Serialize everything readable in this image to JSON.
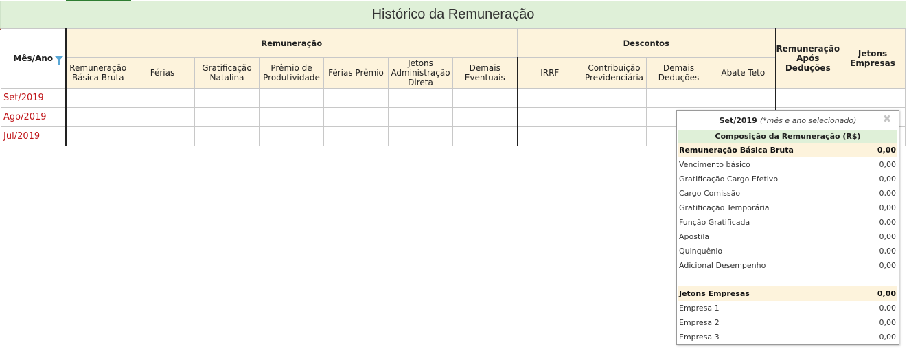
{
  "page": {
    "title": "Histórico da Remuneração"
  },
  "table": {
    "mes_ano_label": "Mês/Ano",
    "groups": {
      "remuneracao": "Remuneração",
      "descontos": "Descontos",
      "remuneracao_apos": "Remuneração Após Deduções",
      "jetons": "Jetons Empresas"
    },
    "remuneracao_cols": [
      "Remuneração Básica Bruta",
      "Férias",
      "Gratificação Natalina",
      "Prêmio de Produtividade",
      "Férias Prêmio",
      "Jetons Administração Direta",
      "Demais Eventuais"
    ],
    "descontos_cols": [
      "IRRF",
      "Contribuição Previdenciária",
      "Demais Deduções",
      "Abate Teto"
    ],
    "rows": [
      {
        "month": "Set/2019"
      },
      {
        "month": "Ago/2019"
      },
      {
        "month": "Jul/2019"
      }
    ]
  },
  "popup": {
    "month": "Set/2019",
    "note": "(*mês e ano selecionado)",
    "close_glyph": "✖",
    "composition_title": "Composição da Remuneração (R$)",
    "basic_header": {
      "label": "Remuneração Básica Bruta",
      "value": "0,00"
    },
    "basic_items": [
      {
        "label": "Vencimento básico",
        "value": "0,00"
      },
      {
        "label": "Gratificação Cargo Efetivo",
        "value": "0,00"
      },
      {
        "label": "Cargo Comissão",
        "value": "0,00"
      },
      {
        "label": "Gratificação Temporária",
        "value": "0,00"
      },
      {
        "label": "Função Gratificada",
        "value": "0,00"
      },
      {
        "label": "Apostila",
        "value": "0,00"
      },
      {
        "label": "Quinquênio",
        "value": "0,00"
      },
      {
        "label": "Adicional Desempenho",
        "value": "0,00"
      }
    ],
    "jetons_header": {
      "label": "Jetons Empresas",
      "value": "0,00"
    },
    "jetons_items": [
      {
        "label": "Empresa 1",
        "value": "0,00"
      },
      {
        "label": "Empresa 2",
        "value": "0,00"
      },
      {
        "label": "Empresa 3",
        "value": "0,00"
      }
    ]
  },
  "colors": {
    "title_bg": "#dff0d8",
    "header_bg": "#fdf3dc",
    "month_text": "#c0161a",
    "accent_line": "#8b1a1a"
  }
}
